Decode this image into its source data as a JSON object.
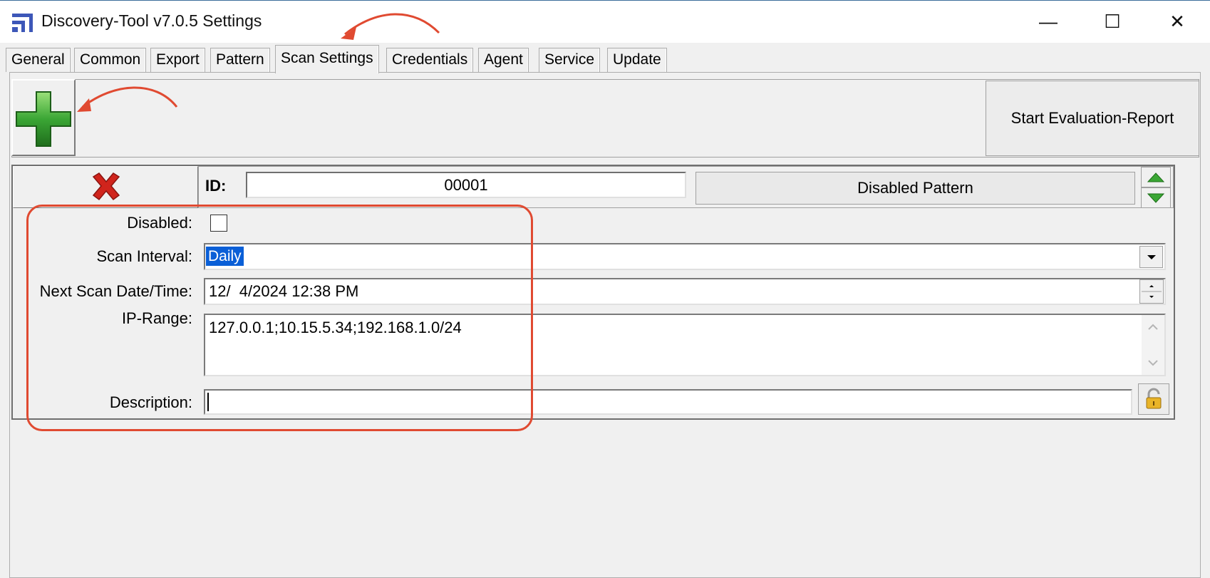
{
  "window": {
    "title": "Discovery-Tool v7.0.5 Settings",
    "controls": {
      "minimize": "—",
      "maximize": "☐",
      "close": "✕"
    }
  },
  "tabs": [
    {
      "label": "General"
    },
    {
      "label": "Common"
    },
    {
      "label": "Export"
    },
    {
      "label": "Pattern"
    },
    {
      "label": "Scan Settings",
      "active": true
    },
    {
      "label": "Credentials"
    },
    {
      "label": "Agent"
    },
    {
      "label": "Service"
    },
    {
      "label": "Update"
    }
  ],
  "toolbar": {
    "add_icon": "plus-icon",
    "evaluation_button": "Start Evaluation-Report"
  },
  "record": {
    "delete_icon": "red-x-icon",
    "id_label": "ID:",
    "id_value": "00001",
    "pattern_button": "Disabled Pattern",
    "move_up_icon": "arrow-up-icon",
    "move_down_icon": "arrow-down-icon"
  },
  "form": {
    "disabled_label": "Disabled:",
    "disabled_checked": false,
    "interval_label": "Scan Interval:",
    "interval_value": "Daily",
    "next_scan_label": "Next Scan Date/Time:",
    "next_scan_value": "12/  4/2024 12:38 PM",
    "ip_range_label": "IP-Range:",
    "ip_range_value": "127.0.0.1;10.15.5.34;192.168.1.0/24",
    "description_label": "Description:",
    "description_value": "",
    "lock_icon": "lock-icon"
  },
  "colors": {
    "accent_annotation": "#e04a31",
    "selection": "#0a5fd7",
    "plus_green": "#3ba635",
    "delete_red": "#d0241c"
  }
}
